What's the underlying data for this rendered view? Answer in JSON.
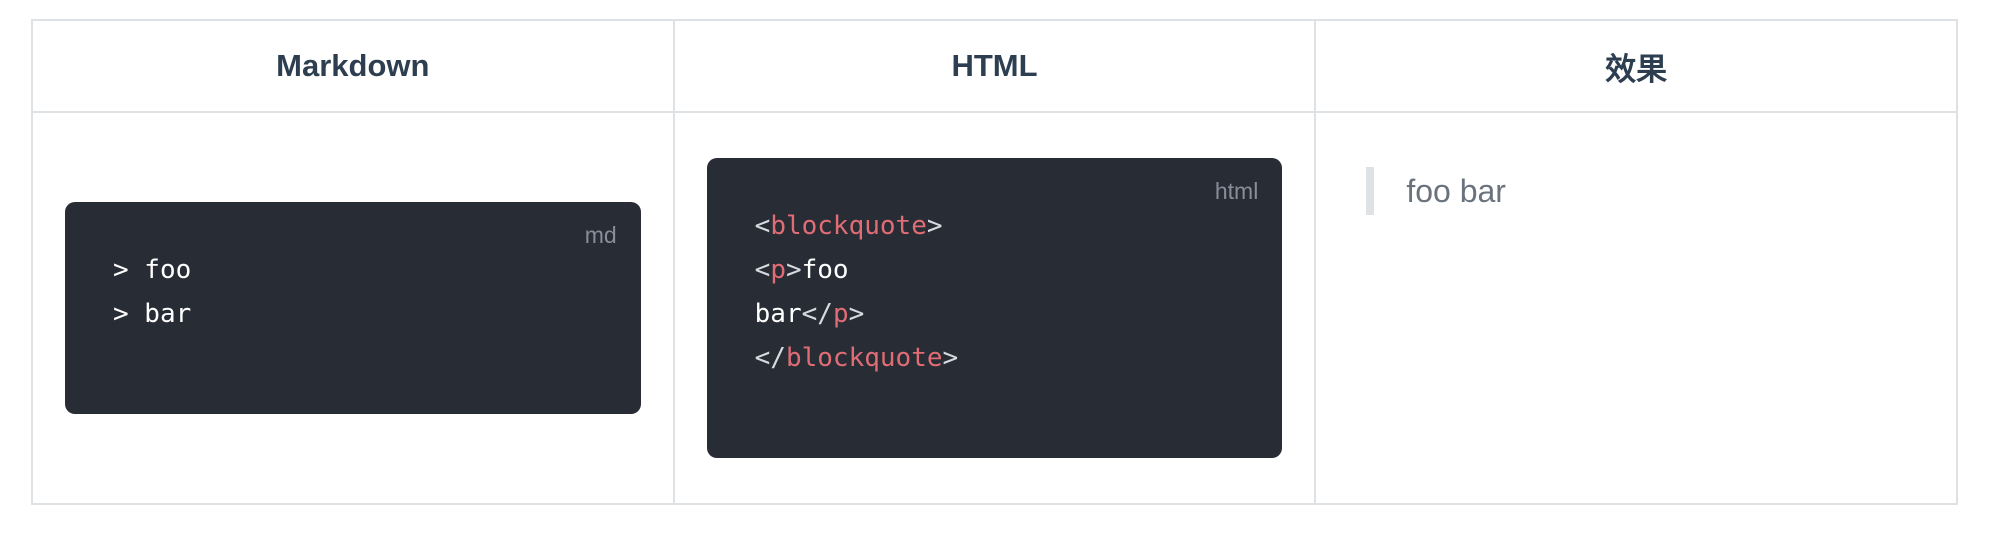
{
  "table": {
    "headers": [
      "Markdown",
      "HTML",
      "效果"
    ],
    "markdown_block": {
      "lang": "md",
      "lines": [
        "> foo",
        "> bar"
      ]
    },
    "html_block": {
      "lang": "html",
      "tokens": {
        "l1_open": "<",
        "l1_tag": "blockquote",
        "l1_close": ">",
        "l2_open": "<",
        "l2_tag": "p",
        "l2_close": ">",
        "l2_text": "foo",
        "l3_text": "bar",
        "l3_open": "</",
        "l3_tag": "p",
        "l3_close": ">",
        "l4_open": "</",
        "l4_tag": "blockquote",
        "l4_close": ">"
      }
    },
    "effect": {
      "quote_text": "foo bar"
    }
  },
  "colors": {
    "code_bg": "#282c34",
    "tag": "#e06c75",
    "quote_border": "#dfe2e5",
    "quote_text": "#6a737d",
    "header_text": "#2c3e50"
  }
}
